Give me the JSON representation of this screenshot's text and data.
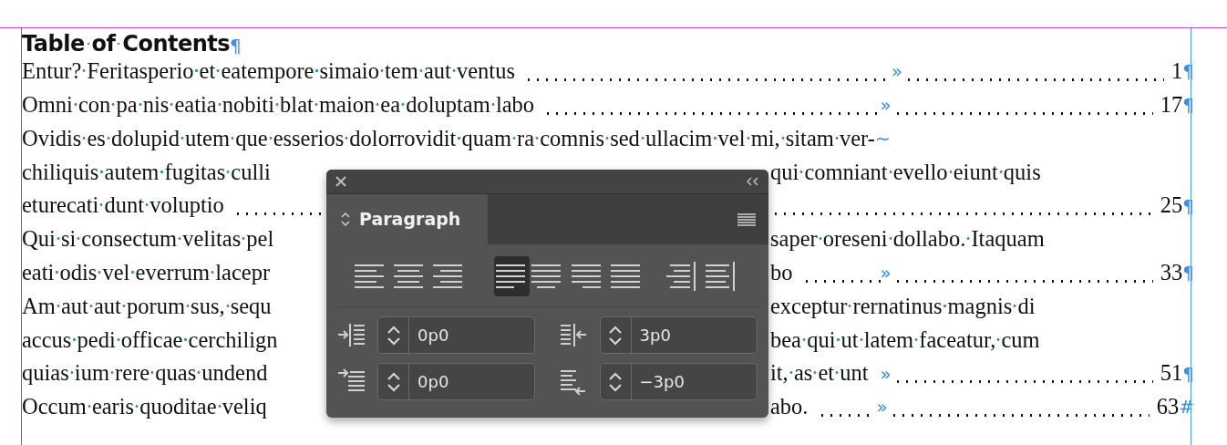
{
  "document": {
    "title": {
      "text": "Table of Contents",
      "end_mark": "¶"
    },
    "lines": [
      {
        "kind": "entry",
        "text": "Entur? Feritasperio et eatempore simaio tem aut ventus",
        "tab_mark": "»",
        "page": "1",
        "end_mark": "¶"
      },
      {
        "kind": "entry",
        "text": "Omni con pa nis eatia nobiti blat maion ea doluptam labo",
        "tab_mark": "»",
        "page": "17",
        "end_mark": "¶"
      },
      {
        "kind": "wrap",
        "text": "Ovidis es dolupid utem que esserios dolorrovidit quam ra comnis sed ullacim vel mi, sitam ver-",
        "hyphen_mark": "~"
      },
      {
        "kind": "wrap",
        "text": "chiliquis autem fugitas culli",
        "after_panel": "qui comniant evello eiunt quis"
      },
      {
        "kind": "entry",
        "text": "eturecati dunt voluptio",
        "page": "25",
        "end_mark": "¶"
      },
      {
        "kind": "wrap",
        "text": "Qui si consectum velitas pel",
        "after_panel": "saper oreseni dollabo. Itaquam"
      },
      {
        "kind": "entry",
        "text": "eati odis vel everrum lacepr",
        "after_panel": "bo",
        "tab_mark": "»",
        "page": "33",
        "end_mark": "¶"
      },
      {
        "kind": "wrap",
        "text": "Am aut aut porum sus, sequ",
        "after_panel": "exceptur rernatinus magnis di"
      },
      {
        "kind": "wrap",
        "text": "accus pedi officae cerchilign",
        "after_panel": "bea qui ut latem faceatur, cum"
      },
      {
        "kind": "entry",
        "text": "quias ium rere quas undend",
        "after_panel": "it, as et unt",
        "tab_mark": "»",
        "page": "51",
        "end_mark": "¶"
      },
      {
        "kind": "entry",
        "text": "Occum earis quoditae veliq",
        "after_panel": "abo.",
        "tab_mark": "»",
        "page": "63",
        "end_mark": "#"
      }
    ]
  },
  "panel": {
    "tab": "Paragraph",
    "alignment_buttons": [
      {
        "kind": "left",
        "selected": false
      },
      {
        "kind": "center",
        "selected": false
      },
      {
        "kind": "right",
        "selected": false
      },
      {
        "kind": "justify-left",
        "selected": true
      },
      {
        "kind": "justify-center",
        "selected": false
      },
      {
        "kind": "justify-right",
        "selected": false
      },
      {
        "kind": "justify-all",
        "selected": false
      },
      {
        "kind": "toward-spine",
        "selected": false
      },
      {
        "kind": "away-from-spine",
        "selected": false
      }
    ],
    "fields": [
      {
        "kind": "left-indent",
        "value": "0p0"
      },
      {
        "kind": "right-indent",
        "value": "3p0"
      },
      {
        "kind": "first-line-indent",
        "value": "0p0"
      },
      {
        "kind": "last-line-indent",
        "value": "−3p0"
      }
    ]
  }
}
